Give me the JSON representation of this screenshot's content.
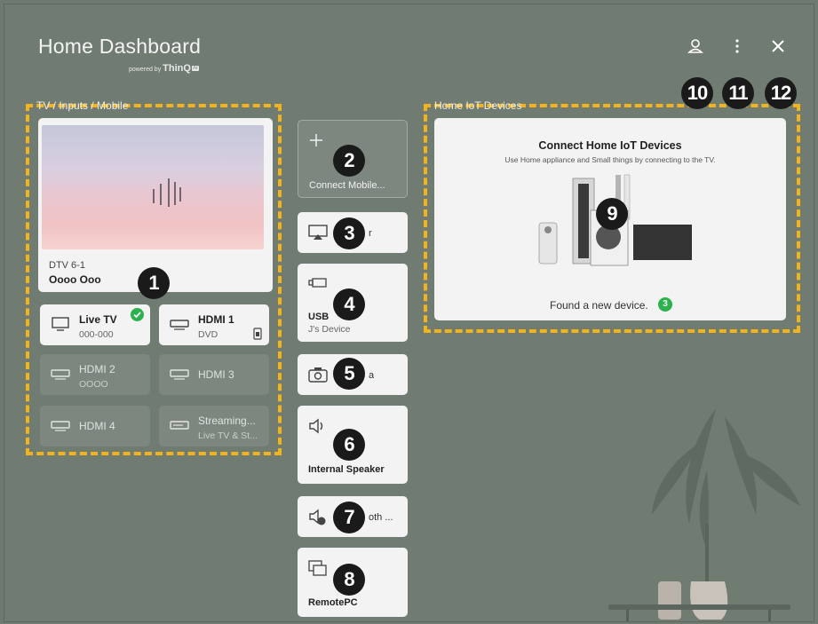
{
  "header": {
    "title": "Home Dashboard",
    "powered_by": "powered by",
    "brand": "ThinQ",
    "brand_ai": "AI"
  },
  "top_icons": [
    "person-icon",
    "more-vertical-icon",
    "close-icon"
  ],
  "sections": {
    "left_label": "TV / Inputs / Mobile",
    "right_label": "Home IoT Devices"
  },
  "tv": {
    "channel": "DTV 6-1",
    "program": "Oooo Ooo"
  },
  "inputs": [
    {
      "name": "Live TV",
      "sub": "000-000",
      "icon": "tv-icon",
      "active": true
    },
    {
      "name": "HDMI 1",
      "sub": "DVD",
      "icon": "hdmi-icon",
      "active": true
    },
    {
      "name": "HDMI 2",
      "sub": "OOOO",
      "icon": "hdmi-icon",
      "active": false
    },
    {
      "name": "HDMI 3",
      "sub": "",
      "icon": "hdmi-icon",
      "active": false
    },
    {
      "name": "HDMI 4",
      "sub": "",
      "icon": "hdmi-icon",
      "active": false
    },
    {
      "name": "Streaming...",
      "sub": "Live TV & St...",
      "icon": "streaming-icon",
      "active": false
    }
  ],
  "middle_cards": [
    {
      "label": "Connect Mobile...",
      "icon": "plus-icon"
    },
    {
      "label": "r",
      "icon": "airplay-icon"
    },
    {
      "label": "USB",
      "sub": "J's Device",
      "icon": "usb-icon"
    },
    {
      "label": "a",
      "icon": "camera-icon"
    },
    {
      "label": "Internal Speaker",
      "icon": "speaker-icon"
    },
    {
      "label": "oth ...",
      "icon": "bluetooth-speaker-icon"
    },
    {
      "label": "RemotePC",
      "icon": "remote-pc-icon"
    }
  ],
  "iot": {
    "heading": "Connect Home IoT Devices",
    "description": "Use Home appliance and Small things by connecting to the TV.",
    "found": "Found a new device.",
    "found_count": "3"
  },
  "badges": [
    "1",
    "2",
    "3",
    "4",
    "5",
    "6",
    "7",
    "8",
    "9",
    "10",
    "11",
    "12"
  ],
  "colors": {
    "background": "#707b71",
    "dashed_border": "#f2b31b",
    "check_green": "#2bb24c",
    "badge": "#1a1a1a"
  }
}
